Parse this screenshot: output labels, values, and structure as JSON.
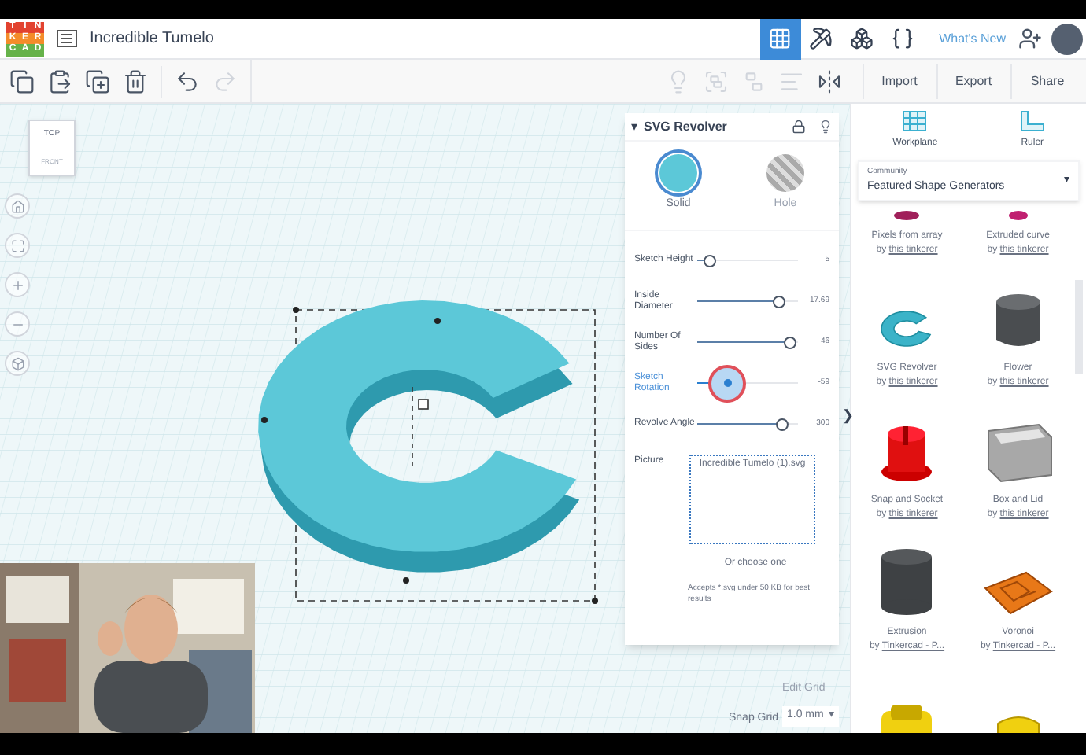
{
  "header": {
    "logo_letters": [
      "T",
      "I",
      "N",
      "K",
      "E",
      "R",
      "C",
      "A",
      "D"
    ],
    "title": "Incredible Tumelo",
    "view_tabs": [
      {
        "kind": "grid",
        "selected": true
      },
      {
        "kind": "pickaxe",
        "selected": false
      },
      {
        "kind": "brick",
        "selected": false
      },
      {
        "kind": "code",
        "selected": false
      }
    ],
    "whats_new": "What's New"
  },
  "toolbar": {
    "edit_tools": [
      {
        "kind": "copy",
        "disabled": false
      },
      {
        "kind": "paste",
        "disabled": false
      },
      {
        "kind": "duplicate",
        "disabled": false
      },
      {
        "kind": "delete",
        "disabled": false
      },
      {
        "kind": "undo",
        "disabled": false
      },
      {
        "kind": "redo",
        "disabled": true
      }
    ],
    "shape_tools": [
      {
        "kind": "bulb",
        "disabled": true
      },
      {
        "kind": "group",
        "disabled": true
      },
      {
        "kind": "ungroup",
        "disabled": true
      },
      {
        "kind": "align",
        "disabled": true
      },
      {
        "kind": "mirror",
        "disabled": false
      }
    ],
    "buttons": [
      "Import",
      "Export",
      "Share"
    ]
  },
  "view_cube": {
    "top": "TOP",
    "front": "FRONT"
  },
  "nav_buttons": [
    {
      "kind": "home"
    },
    {
      "kind": "fit"
    },
    {
      "kind": "zoom-in"
    },
    {
      "kind": "zoom-out"
    },
    {
      "kind": "perspective"
    }
  ],
  "grid_controls": {
    "edit_grid": "Edit Grid",
    "snap_label": "Snap Grid",
    "snap_value": "1.0 mm",
    "caret": "▾"
  },
  "inspector": {
    "caret": "▾",
    "title": "SVG Revolver",
    "modes": [
      {
        "label": "Solid",
        "kind": "solid",
        "selected": true
      },
      {
        "label": "Hole",
        "kind": "hole",
        "selected": false
      }
    ],
    "params": [
      {
        "label": "Sketch Height",
        "level": 0.12,
        "reading": "5",
        "focused": false
      },
      {
        "label": "Inside Diameter",
        "level": 0.82,
        "reading": "17.69",
        "focused": false
      },
      {
        "label": "Number Of Sides",
        "level": 0.92,
        "reading": "46",
        "focused": false
      },
      {
        "label": "Sketch Rotation",
        "level": 0.3,
        "reading": "-59",
        "focused": true
      },
      {
        "label": "Revolve Angle",
        "level": 0.85,
        "reading": "300",
        "focused": false
      }
    ],
    "picture_label": "Picture",
    "file_name": "Incredible Tumelo (1).svg",
    "choose": "Or choose one",
    "accepts": "Accepts *.svg under 50 KB for best results"
  },
  "library": {
    "tools": [
      {
        "label": "Workplane",
        "kind": "workplane"
      },
      {
        "label": "Ruler",
        "kind": "ruler"
      }
    ],
    "category_label": "Community",
    "category": "Featured Shape Generators",
    "caret": "▾",
    "shapes": [
      {
        "kind": "pixels",
        "name": "Pixels from array",
        "by": "by",
        "author": "this tinkerer"
      },
      {
        "kind": "curve",
        "name": "Extruded curve",
        "by": "by",
        "author": "this tinkerer"
      },
      {
        "kind": "ring",
        "name": "SVG Revolver",
        "by": "by",
        "author": "this tinkerer"
      },
      {
        "kind": "flower",
        "name": "Flower",
        "by": "by",
        "author": "this tinkerer"
      },
      {
        "kind": "snap",
        "name": "Snap and Socket",
        "by": "by",
        "author": "this tinkerer"
      },
      {
        "kind": "box",
        "name": "Box and Lid",
        "by": "by",
        "author": "this tinkerer"
      },
      {
        "kind": "cylinder",
        "name": "Extrusion",
        "by": "by",
        "author": "Tinkercad - P..."
      },
      {
        "kind": "voronoi",
        "name": "Voronoi",
        "by": "by",
        "author": "Tinkercad - P..."
      },
      {
        "kind": "cup"
      },
      {
        "kind": "wedge"
      }
    ]
  },
  "panel_toggle": "❯"
}
